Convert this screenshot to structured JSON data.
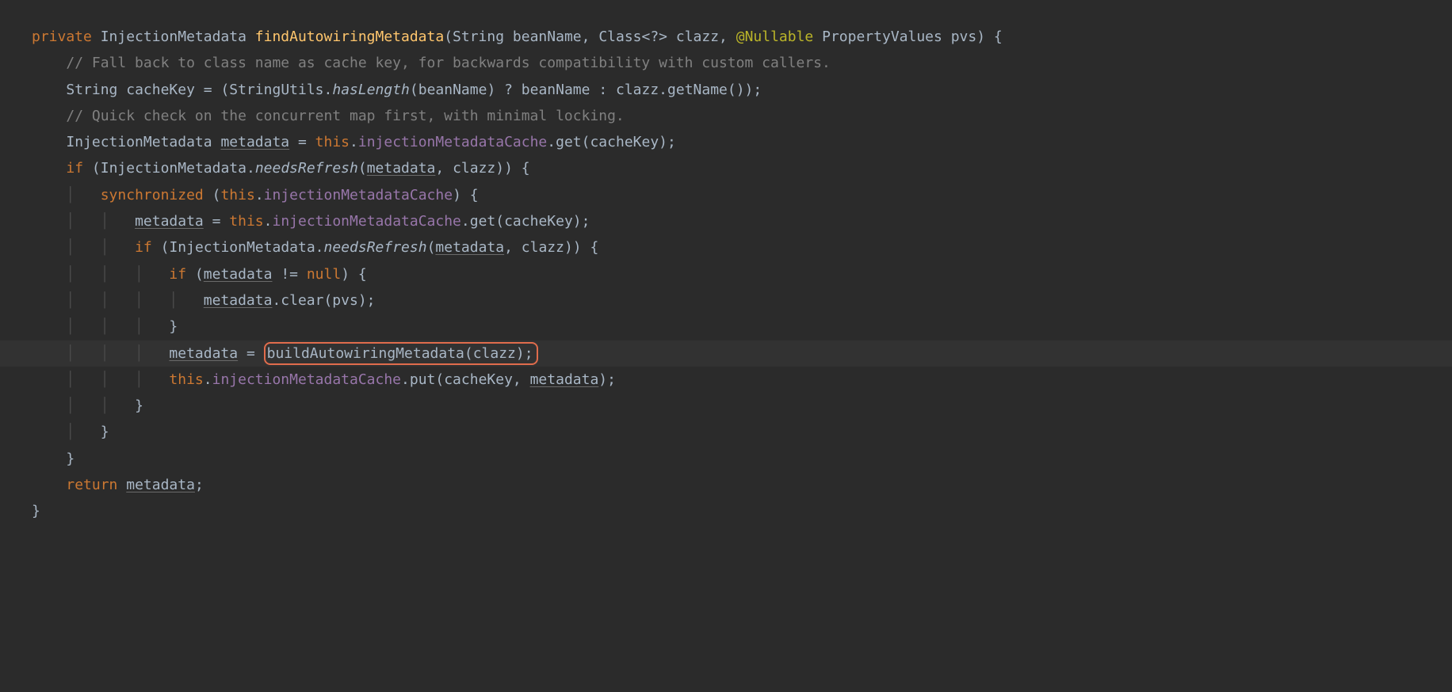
{
  "code": {
    "l1": {
      "private": "private",
      "type1": "InjectionMetadata",
      "method": "findAutowiringMetadata",
      "p1t": "String",
      "p1n": "beanName",
      "p2t": "Class",
      "p2g": "<?>",
      "p2n": "clazz",
      "ann": "@Nullable",
      "p3t": "PropertyValues",
      "p3n": "pvs"
    },
    "l2": "// Fall back to class name as cache key, for backwards compatibility with custom callers.",
    "l3": {
      "type": "String",
      "var": "cacheKey",
      "eq": " = (",
      "cls": "StringUtils",
      "dot": ".",
      "m": "hasLength",
      "arg": "(beanName) ? beanName : clazz.getName());"
    },
    "l4": "// Quick check on the concurrent map first, with minimal locking.",
    "l5": {
      "type": "InjectionMetadata",
      "var": "metadata",
      "eq": " = ",
      "this": "this",
      "rest1": ".",
      "field": "injectionMetadataCache",
      "rest2": ".get(cacheKey);"
    },
    "l6": {
      "if": "if",
      "open": " (",
      "cls": "InjectionMetadata",
      "dot": ".",
      "m": "needsRefresh",
      "open2": "(",
      "arg1": "metadata",
      "rest": ", clazz)) {"
    },
    "l7": {
      "sync": "synchronized",
      "open": " (",
      "this": "this",
      "dot": ".",
      "field": "injectionMetadataCache",
      "close": ") {"
    },
    "l8": {
      "var": "metadata",
      "eq": " = ",
      "this": "this",
      "dot": ".",
      "field": "injectionMetadataCache",
      "rest": ".get(cacheKey);"
    },
    "l9": {
      "if": "if",
      "open": " (",
      "cls": "InjectionMetadata",
      "dot": ".",
      "m": "needsRefresh",
      "open2": "(",
      "arg1": "metadata",
      "rest": ", clazz)) {"
    },
    "l10": {
      "if": "if",
      "open": " (",
      "var": "metadata",
      "rest": " != ",
      "null": "null",
      "close": ") {"
    },
    "l11": {
      "var": "metadata",
      "rest": ".clear(pvs);"
    },
    "l12": "}",
    "l13": {
      "var": "metadata",
      "eq": " = ",
      "boxed": "buildAutowiringMetadata(clazz);"
    },
    "l14": {
      "this": "this",
      "dot": ".",
      "field": "injectionMetadataCache",
      "rest": ".put(cacheKey, ",
      "arg": "metadata",
      "close": ");"
    },
    "l15": "}",
    "l16": "}",
    "l17": "}",
    "l18": {
      "return": "return",
      "sp": " ",
      "var": "metadata",
      "semi": ";"
    },
    "l19": "}"
  }
}
